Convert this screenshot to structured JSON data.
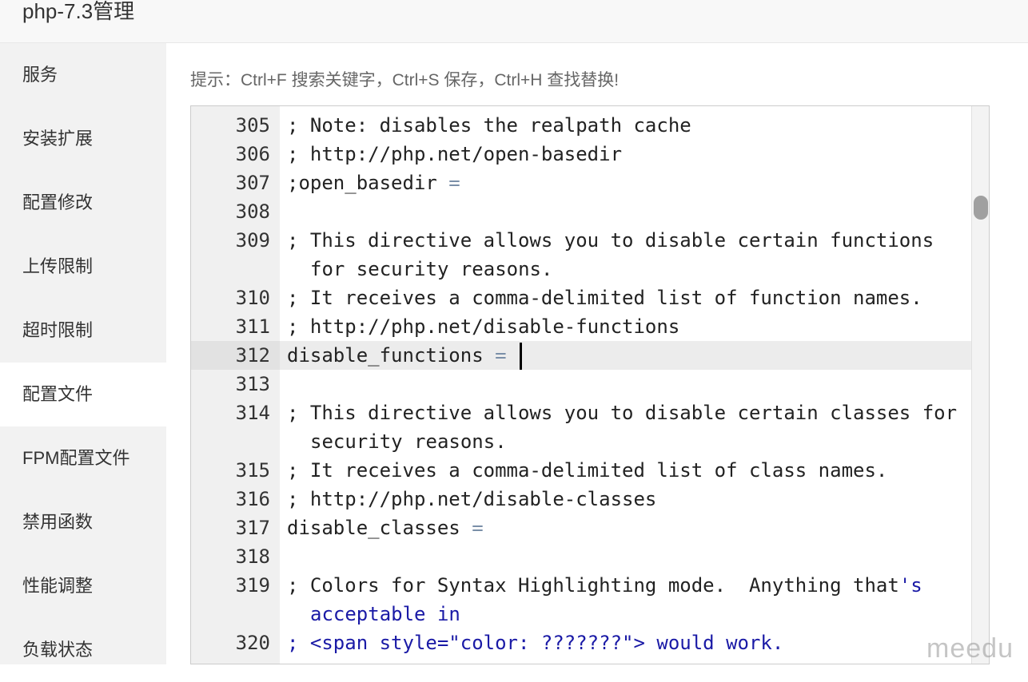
{
  "window": {
    "title": "php-7.3管理"
  },
  "sidebar": {
    "items": [
      {
        "label": "服务"
      },
      {
        "label": "安装扩展"
      },
      {
        "label": "配置修改"
      },
      {
        "label": "上传限制"
      },
      {
        "label": "超时限制"
      },
      {
        "label": "配置文件"
      },
      {
        "label": "FPM配置文件"
      },
      {
        "label": "禁用函数"
      },
      {
        "label": "性能调整"
      },
      {
        "label": "负载状态"
      }
    ],
    "active_item": "配置文件"
  },
  "hint": {
    "text": "提示：Ctrl+F 搜索关键字，Ctrl+S 保存，Ctrl+H 查找替换!"
  },
  "editor": {
    "current_line": 312,
    "lines": [
      {
        "num": "305",
        "text": "; Note: disables the realpath cache"
      },
      {
        "num": "306",
        "text": "; http://php.net/open-basedir"
      },
      {
        "num": "307",
        "text": ";open_basedir",
        "op": " ="
      },
      {
        "num": "308",
        "text": ""
      },
      {
        "num": "309",
        "text": "; This directive allows you to disable certain functions for security reasons."
      },
      {
        "num": "310",
        "text": "; It receives a comma-delimited list of function names."
      },
      {
        "num": "311",
        "text": "; http://php.net/disable-functions"
      },
      {
        "num": "312",
        "text": "disable_functions",
        "op": " = "
      },
      {
        "num": "313",
        "text": ""
      },
      {
        "num": "314",
        "text": "; This directive allows you to disable certain classes for security reasons."
      },
      {
        "num": "315",
        "text": "; It receives a comma-delimited list of class names."
      },
      {
        "num": "316",
        "text": "; http://php.net/disable-classes"
      },
      {
        "num": "317",
        "text": "disable_classes",
        "op": " ="
      },
      {
        "num": "318",
        "text": ""
      },
      {
        "num": "319",
        "text": "; Colors for Syntax Highlighting mode.  Anything that",
        "blue": "'s acceptable in"
      },
      {
        "num": "320",
        "text": "",
        "blue": "; <span style=\"color: ???????\"> would work."
      }
    ]
  },
  "watermark": {
    "text": "meedu"
  },
  "colors": {
    "sidebar_bg": "#f2f2f2",
    "active_item_bg": "#ffffff",
    "gutter_bg": "#f0f0f0",
    "active_line_bg": "#ececec",
    "operator": "#7a8fa8",
    "string_blue": "#1a1aa6"
  }
}
